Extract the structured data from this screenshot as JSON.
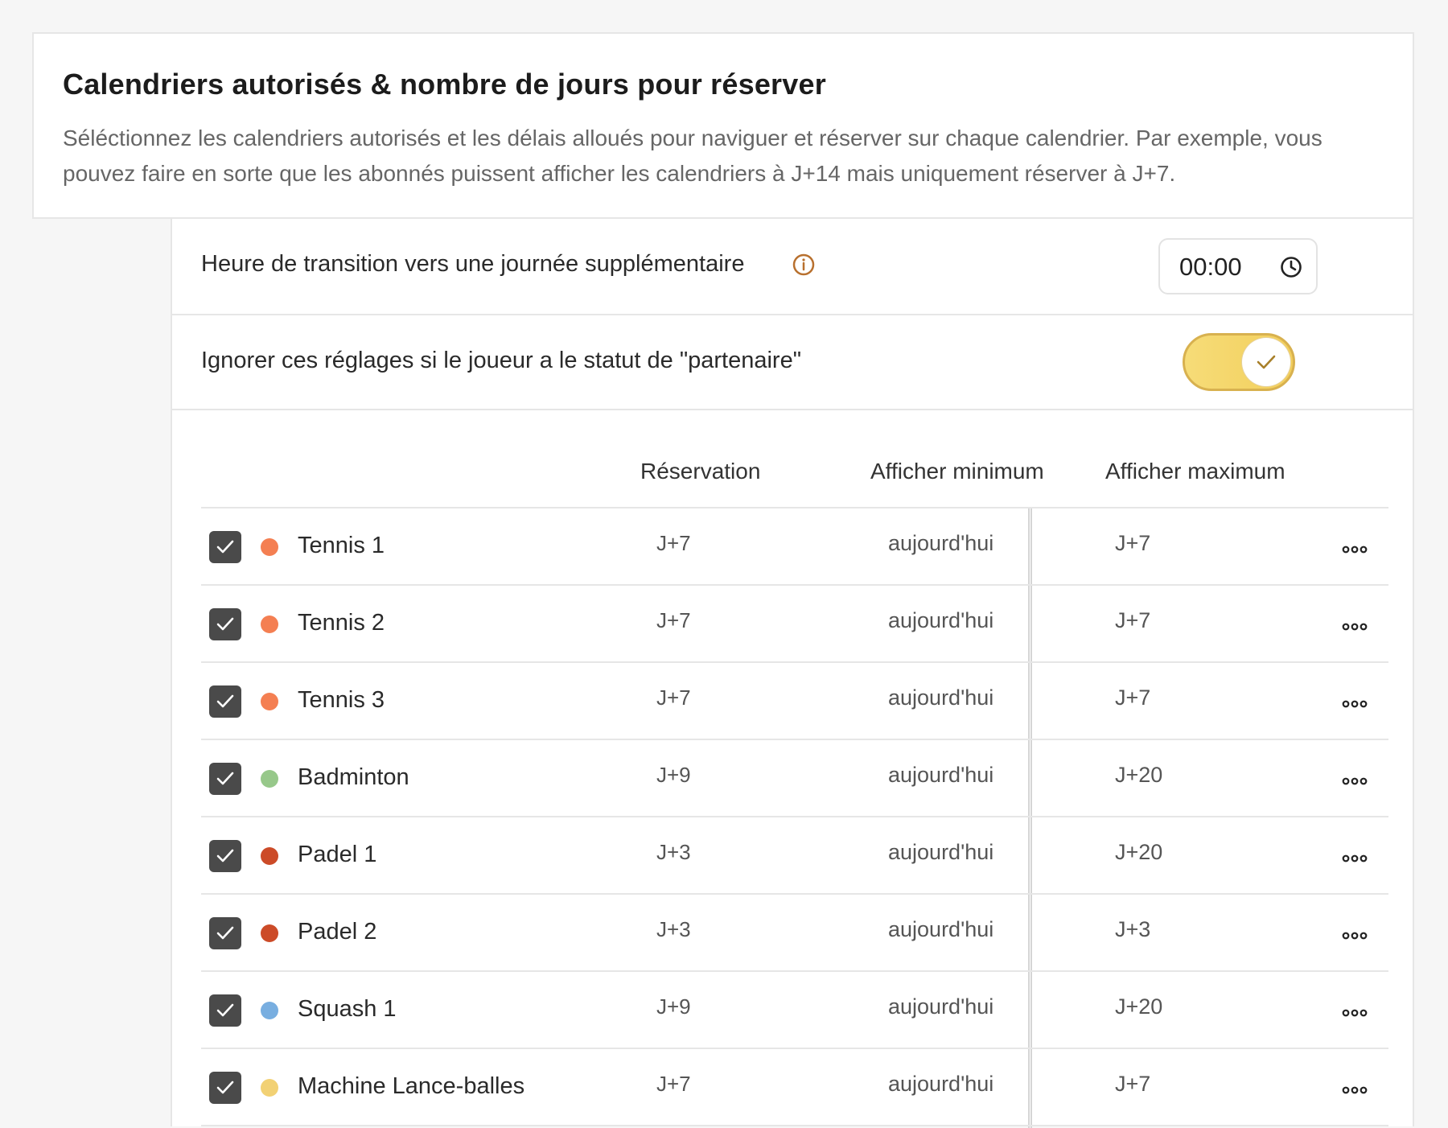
{
  "header": {
    "title": "Calendriers autorisés & nombre de jours pour réserver",
    "description": "Séléctionnez les calendriers autorisés et les délais alloués pour naviguer et réserver sur chaque calendrier. Par exemple, vous pouvez faire en sorte que les abonnés puissent afficher les calendriers à J+14 mais uniquement réserver à J+7."
  },
  "settings": {
    "transition_label": "Heure de transition vers une journée supplémentaire",
    "transition_time": "00:00",
    "partner_label": "Ignorer ces réglages si le joueur a le statut de \"partenaire\"",
    "partner_enabled": true
  },
  "colors": {
    "accent": "#f3cf5c",
    "accent_border": "#d8b14f",
    "info_icon": "#b8702e",
    "checkbox": "#4a4a4a"
  },
  "table": {
    "columns": [
      "Réservation",
      "Afficher minimum",
      "Afficher maximum"
    ],
    "rows": [
      {
        "name": "Tennis 1",
        "color": "#f47f52",
        "reservation": "J+7",
        "min": "aujourd'hui",
        "max": "J+7"
      },
      {
        "name": "Tennis 2",
        "color": "#f47f52",
        "reservation": "J+7",
        "min": "aujourd'hui",
        "max": "J+7"
      },
      {
        "name": "Tennis 3",
        "color": "#f47f52",
        "reservation": "J+7",
        "min": "aujourd'hui",
        "max": "J+7"
      },
      {
        "name": "Badminton",
        "color": "#97c88a",
        "reservation": "J+9",
        "min": "aujourd'hui",
        "max": "J+20"
      },
      {
        "name": "Padel 1",
        "color": "#cc4b28",
        "reservation": "J+3",
        "min": "aujourd'hui",
        "max": "J+20"
      },
      {
        "name": "Padel 2",
        "color": "#cc4b28",
        "reservation": "J+3",
        "min": "aujourd'hui",
        "max": "J+3"
      },
      {
        "name": "Squash 1",
        "color": "#78aee0",
        "reservation": "J+9",
        "min": "aujourd'hui",
        "max": "J+20"
      },
      {
        "name": "Machine Lance-balles",
        "color": "#f2d174",
        "reservation": "J+7",
        "min": "aujourd'hui",
        "max": "J+7"
      }
    ]
  }
}
